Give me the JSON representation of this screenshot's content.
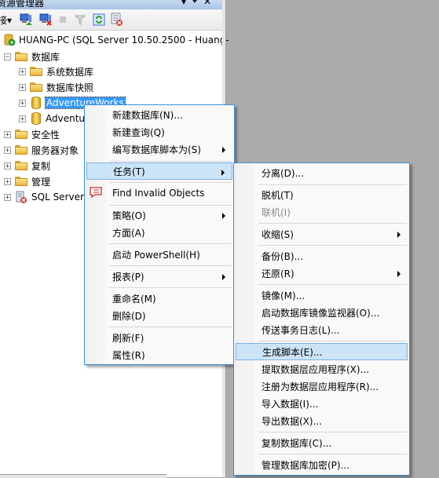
{
  "panel": {
    "title": "资源管理器",
    "title_buttons": [
      "▾",
      "ꟷ",
      "✕"
    ],
    "toolbar": {
      "connect_label": "接▾",
      "icons": [
        "connect-icon",
        "disconnect-icon",
        "stop-icon",
        "filter-icon",
        "refresh-icon",
        "script-error-icon"
      ]
    }
  },
  "tree": {
    "server": "HUANG-PC (SQL Server 10.50.2500 - Huang-",
    "databases": "数据库",
    "system_dbs": "系统数据库",
    "snapshots": "数据库快照",
    "adventureworks": "AdventureWorks",
    "adventureworks2": "Adventu",
    "security": "安全性",
    "server_objects": "服务器对象",
    "replication": "复制",
    "management": "管理",
    "agent": "SQL Server"
  },
  "context_menu": {
    "items": [
      {
        "label": "新建数据库(N)..."
      },
      {
        "label": "新建查询(Q)"
      },
      {
        "label": "编写数据库脚本为(S)",
        "submenu": true
      },
      {
        "label": "任务(T)",
        "submenu": true,
        "highlighted": true
      },
      {
        "label": "Find Invalid Objects",
        "icon": "find-invalid-objects-icon"
      },
      {
        "label": "策略(O)",
        "submenu": true
      },
      {
        "label": "方面(A)"
      },
      {
        "label": "启动 PowerShell(H)"
      },
      {
        "label": "报表(P)",
        "submenu": true
      },
      {
        "label": "重命名(M)"
      },
      {
        "label": "删除(D)"
      },
      {
        "label": "刷新(F)"
      },
      {
        "label": "属性(R)"
      }
    ]
  },
  "tasks_menu": {
    "items": [
      {
        "label": "分离(D)..."
      },
      {
        "label": "脱机(T)"
      },
      {
        "label": "联机(I)",
        "disabled": true
      },
      {
        "label": "收缩(S)",
        "submenu": true
      },
      {
        "label": "备份(B)..."
      },
      {
        "label": "还原(R)",
        "submenu": true
      },
      {
        "label": "镜像(M)..."
      },
      {
        "label": "启动数据库镜像监视器(O)..."
      },
      {
        "label": "传送事务日志(L)..."
      },
      {
        "label": "生成脚本(E)...",
        "highlighted": true
      },
      {
        "label": "提取数据层应用程序(X)..."
      },
      {
        "label": "注册为数据层应用程序(R)..."
      },
      {
        "label": "导入数据(I)..."
      },
      {
        "label": "导出数据(X)..."
      },
      {
        "label": "复制数据库(C)..."
      },
      {
        "label": "管理数据库加密(P)..."
      }
    ]
  },
  "colors": {
    "accent": "#3399ff",
    "menu_highlight": "#cce4f7",
    "menu_border": "#3c8fd8",
    "background": "#ababab"
  }
}
